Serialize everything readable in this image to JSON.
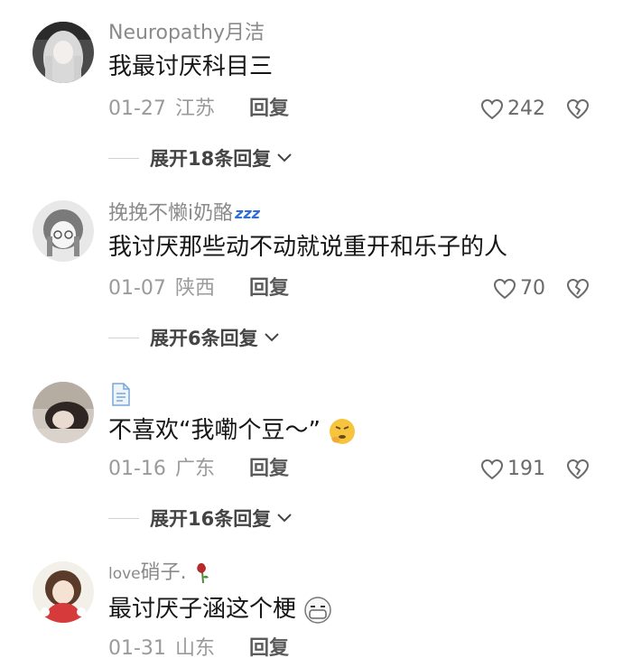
{
  "comments": [
    {
      "username": "Neuropathy月洁",
      "text": "我最讨厌科目三",
      "date": "01-27",
      "location": "江苏",
      "reply_label": "回复",
      "likes": "242",
      "expand_label": "展开18条回复"
    },
    {
      "username": "挽挽不懒i奶酪",
      "username_suffix": "zzz",
      "text": "我讨厌那些动不动就说重开和乐子的人",
      "date": "01-07",
      "location": "陕西",
      "reply_label": "回复",
      "likes": "70",
      "expand_label": "展开6条回复"
    },
    {
      "username_icon": "document-icon",
      "text": "不喜欢“我嘞个豆～”",
      "text_emoji": "thinking-face-emoji",
      "date": "01-16",
      "location": "广东",
      "reply_label": "回复",
      "likes": "191",
      "expand_label": "展开16条回复"
    },
    {
      "username_prefix": "love",
      "username": "硝子.",
      "username_emoji": "wilted-rose-emoji",
      "text": "最讨厌子涵这个梗",
      "text_emoji": "mask-face-emoji",
      "date": "01-31",
      "location": "山东",
      "reply_label": "回复"
    }
  ],
  "colors": {
    "username": "#8a8a8a",
    "text": "#161616",
    "meta": "#9a9a9a",
    "reply": "#5a5a5a"
  }
}
